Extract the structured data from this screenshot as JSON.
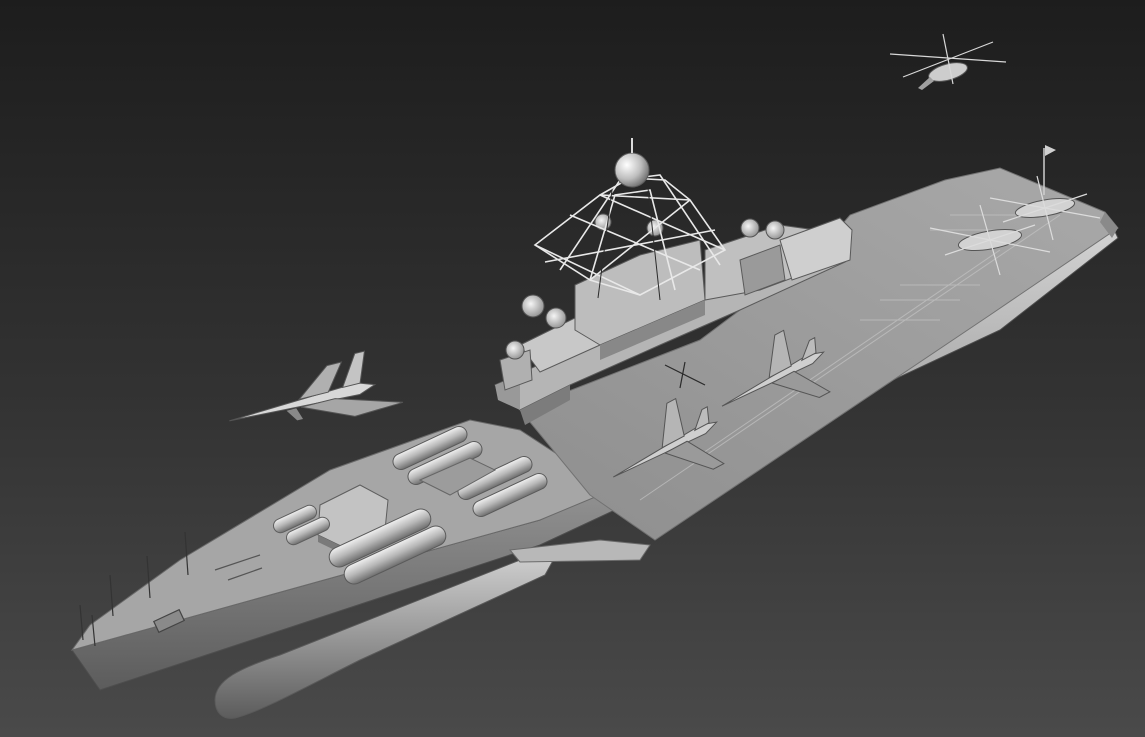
{
  "scene": {
    "background_top": "#1e1e1e",
    "background_bottom": "#4a4a4a",
    "model_color": "#b0b0b0",
    "model_highlight": "#e2e2e2",
    "model_shadow": "#6a6a6a",
    "objects": [
      "aircraft-carrier-cruiser",
      "fighter-jet-airborne",
      "helicopter-airborne",
      "fighter-jets-on-deck",
      "helicopters-on-deck",
      "radar-mast",
      "missile-launchers",
      "gun-turret"
    ]
  }
}
